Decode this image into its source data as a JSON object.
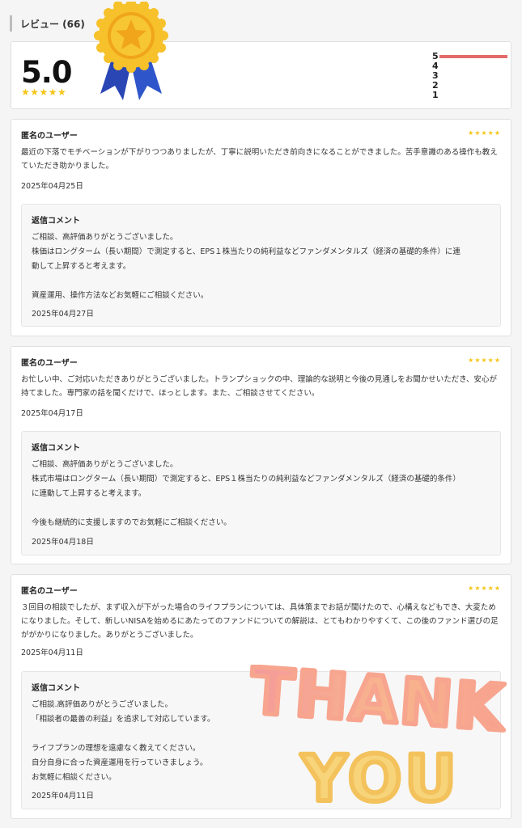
{
  "header": {
    "title": "レビュー (66)"
  },
  "summary": {
    "score": "5.0",
    "stars": "★★★★★",
    "distribution": [
      {
        "label": "5",
        "fraction": 1.0
      },
      {
        "label": "4",
        "fraction": 0
      },
      {
        "label": "3",
        "fraction": 0
      },
      {
        "label": "2",
        "fraction": 0
      },
      {
        "label": "1",
        "fraction": 0
      }
    ]
  },
  "colors": {
    "star": "#f5c518",
    "bar": "#e46a6a",
    "medal_gold": "#f3b81c",
    "ribbon_blue": "#2a46b5"
  },
  "reviews": [
    {
      "author": "匿名のユーザー",
      "stars": "★★★★★",
      "text": "最近の下落でモチベーションが下がりつつありましたが、丁寧に説明いただき前向きになることができました。苦手意識のある操作も教えていただき助かりました。",
      "date": "2025年04月25日",
      "reply": {
        "title": "返信コメント",
        "lines": [
          "ご相談、高評価ありがとうございました。",
          "株価はロングターム（長い期間）で測定すると、EPS１株当たりの純利益などファンダメンタルズ（経済の基礎的条件）に連",
          "動して上昇すると考えます。",
          "",
          "資産運用、操作方法などお気軽にご相談ください。"
        ],
        "date": "2025年04月27日"
      }
    },
    {
      "author": "匿名のユーザー",
      "stars": "★★★★★",
      "text": "お忙しい中、ご対応いただきありがとうございました。トランプショックの中、理論的な説明と今後の見通しをお聞かせいただき、安心が持てました。専門家の話を聞くだけで、ほっとします。また、ご相談させてください。",
      "date": "2025年04月17日",
      "reply": {
        "title": "返信コメント",
        "lines": [
          "ご相談、高評価ありがとうございました。",
          "株式市場はロングターム（長い期間）で測定すると、EPS１株当たりの純利益などファンダメンタルズ（経済の基礎的条件）",
          "に連動して上昇すると考えます。",
          "",
          "今後も継続的に支援しますのでお気軽にご相談ください。"
        ],
        "date": "2025年04月18日"
      }
    },
    {
      "author": "匿名のユーザー",
      "stars": "★★★★★",
      "text": "３回目の相談でしたが、まず収入が下がった場合のライフプランについては、具体策までお話が聞けたので、心構えなどもでき、大変ためになりました。そして、新しいNISAを始めるにあたってのファンドについての解説は、とてもわかりやすくて、この後のファンド選びの足ががかりになりました。ありがとうございました。",
      "date": "2025年04月11日",
      "reply": {
        "title": "返信コメント",
        "lines": [
          "ご相談.高評価ありがとうございました。",
          "「相談者の最善の利益」を追求して対応しています。",
          "",
          "ライフプランの理想を遠慮なく教えてください。",
          "自分自身に合った資産運用を行っていきましょう。",
          "お気軽に相談ください。"
        ],
        "date": "2025年04月11日"
      }
    }
  ],
  "sticker": {
    "line1": "THANK",
    "line2": "YOU"
  }
}
